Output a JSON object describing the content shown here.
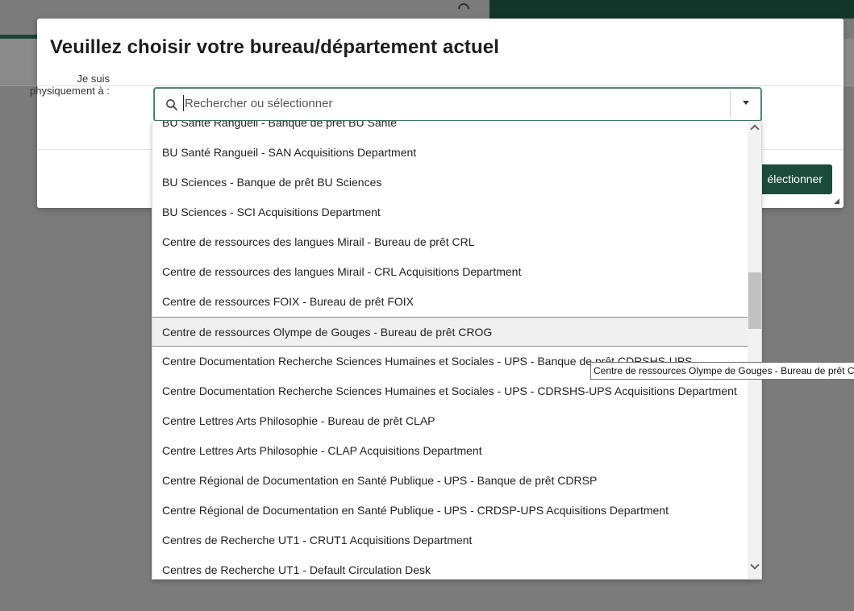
{
  "dialog": {
    "title": "Veuillez choisir votre bureau/département actuel",
    "field_label": "Je suis physiquement à :",
    "select_placeholder": "Rechercher ou sélectionner",
    "select_button": "électionner"
  },
  "options": [
    "BU Santé Rangueil - Banque de prêt BU Santé",
    "BU Santé Rangueil - SAN Acquisitions Department",
    "BU Sciences - Banque de prêt BU Sciences",
    "BU Sciences - SCI Acquisitions Department",
    "Centre de ressources des langues Mirail - Bureau de prêt CRL",
    "Centre de ressources des langues Mirail - CRL Acquisitions Department",
    "Centre de ressources FOIX - Bureau de prêt FOIX",
    "Centre de ressources Olympe de Gouges - Bureau de prêt CROG",
    "Centre Documentation Recherche Sciences Humaines et Sociales - UPS - Banque de prêt CDRSHS-UPS",
    "Centre Documentation Recherche Sciences Humaines et Sociales - UPS - CDRSHS-UPS Acquisitions Department",
    "Centre Lettres Arts Philosophie - Bureau de prêt CLAP",
    "Centre Lettres Arts Philosophie - CLAP Acquisitions Department",
    "Centre Régional de Documentation en Santé Publique - UPS - Banque de prêt CDRSP",
    "Centre Régional de Documentation en Santé Publique - UPS - CRDSP-UPS Acquisitions Department",
    "Centres de Recherche UT1 - CRUT1 Acquisitions Department",
    "Centres de Recherche UT1 - Default Circulation Desk"
  ],
  "highlighted_index": 7,
  "tooltip": "Centre de ressources Olympe de Gouges - Bureau de prêt CROG",
  "colors": {
    "primary_button": "#1b4c3b",
    "top_bar": "#12362a"
  }
}
